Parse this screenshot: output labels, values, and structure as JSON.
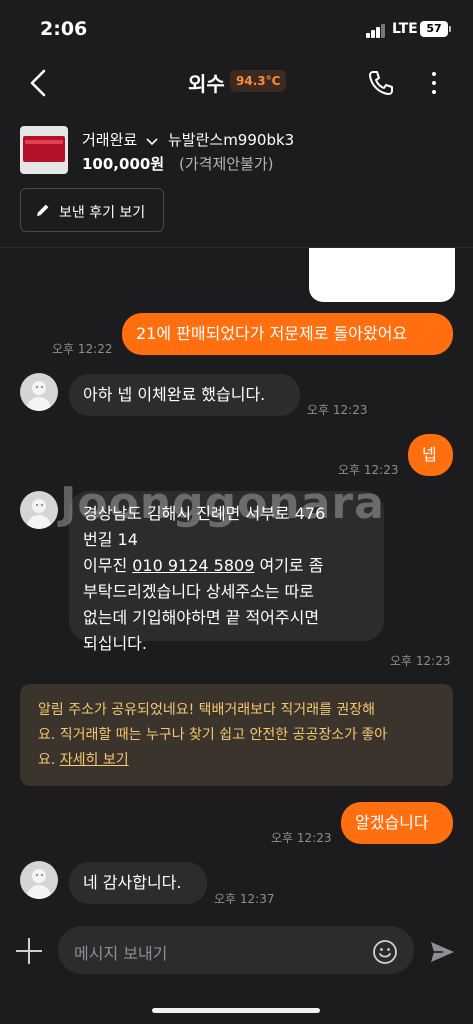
{
  "status_bar": {
    "time": "2:06",
    "network": "LTE",
    "battery": "57"
  },
  "header": {
    "title": "외수",
    "temperature": "94.3°C"
  },
  "product": {
    "status": "거래완료",
    "name": "뉴발란스m990bk3",
    "price": "100,000원",
    "price_note": "(가격제안불가)",
    "review_button": "보낸 후기 보기"
  },
  "messages": {
    "m1": {
      "text": "21에 판매되었다가 저문제로 돌아왔어요",
      "time": "오후 12:22"
    },
    "m2": {
      "text": "아하 넵 이체완료 했습니다.",
      "time": "오후 12:23"
    },
    "m3": {
      "text": "넵",
      "time": "오후 12:23"
    },
    "m4": {
      "line1": "경상남도 김해시 진례면 서부로 476",
      "line2": "번길 14",
      "line3_prefix": "이무진 ",
      "phone": "010 9124 5809",
      "line3_suffix": " 여기로 좀",
      "line4": "부탁드리겠습니다  상세주소는 따로",
      "line5": "없는데 기입해야하면 끝 적어주시면",
      "line6": "되십니다.",
      "time": "오후 12:23"
    },
    "m5": {
      "text": "알겠습니다",
      "time": "오후 12:23"
    },
    "m6": {
      "text": "네 감사합니다.",
      "time": "오후 12:37"
    }
  },
  "notice": {
    "line1": "알림  주소가 공유되었네요! 택배거래보다 직거래를 권장해",
    "line2": "요. 직거래할 때는 누구나 찾기 쉽고 안전한 공공장소가 좋아",
    "line3_prefix": "요. ",
    "link": "자세히 보기"
  },
  "watermark": "Joonggonara",
  "input": {
    "placeholder": "메시지 보내기"
  },
  "colors": {
    "accent": "#ff6f0f",
    "background": "#1c1c1e",
    "bubble_in": "#2c2c2e",
    "notice_text": "#f5c870"
  }
}
